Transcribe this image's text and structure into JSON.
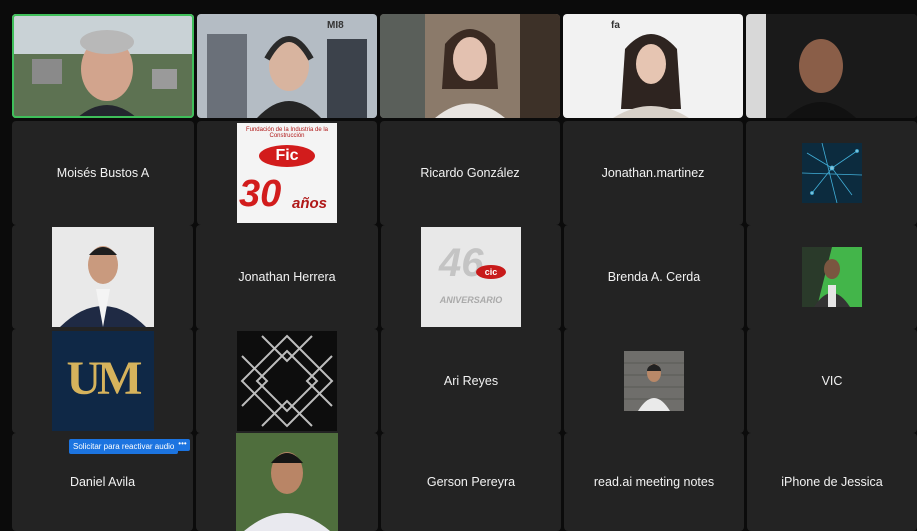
{
  "participants": {
    "row1": [
      {
        "name": ""
      },
      {
        "name": "",
        "watermark": "MI8"
      },
      {
        "name": ""
      },
      {
        "name": "",
        "watermark": "fa"
      },
      {
        "name": ""
      }
    ],
    "row2": [
      {
        "name": "Moisés Bustos A"
      },
      {
        "name": "",
        "logo_text_a": "Fic",
        "logo_text_b": "30",
        "logo_text_c": "años",
        "logo_caption": "Fundación de la Industria de la Construcción"
      },
      {
        "name": "Ricardo González"
      },
      {
        "name": "Jonathan.martinez"
      },
      {
        "name": ""
      }
    ],
    "row3": [
      {
        "name": ""
      },
      {
        "name": "Jonathan Herrera"
      },
      {
        "name": "",
        "logo_text_a": "46",
        "logo_text_b": "cic",
        "logo_text_c": "ANIVERSARIO"
      },
      {
        "name": "Brenda A. Cerda"
      },
      {
        "name": ""
      }
    ],
    "row4": [
      {
        "name": "",
        "logo_text_a": "UM"
      },
      {
        "name": ""
      },
      {
        "name": "Ari Reyes"
      },
      {
        "name": ""
      },
      {
        "name": "VIC"
      }
    ],
    "row5": [
      {
        "name": "Daniel Avila"
      },
      {
        "name": ""
      },
      {
        "name": "Gerson Pereyra"
      },
      {
        "name": "read.ai meeting notes"
      },
      {
        "name": "iPhone de Jessica"
      }
    ]
  },
  "unmute_request": {
    "label": "Solicitar para reactivar audio",
    "more_label": "•••"
  },
  "colors": {
    "active_speaker": "#3fbf5a",
    "tile_bg": "#232323",
    "accent_blue": "#1c74e0"
  }
}
